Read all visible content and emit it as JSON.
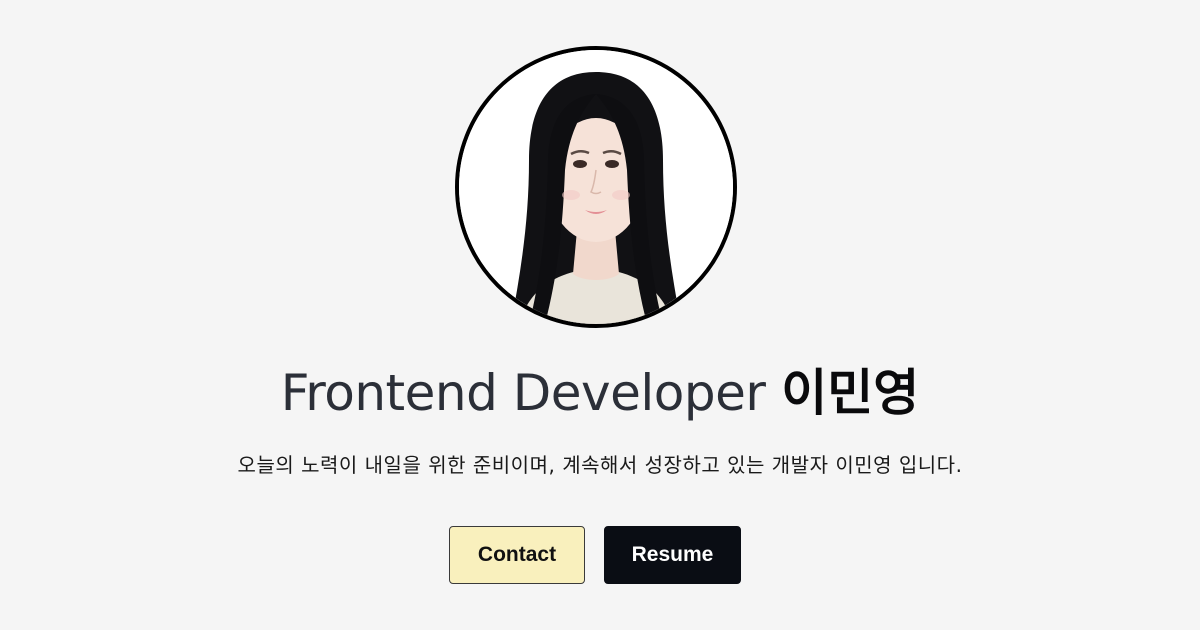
{
  "hero": {
    "role": "Frontend Developer",
    "name": "이민영",
    "intro": "오늘의 노력이 내일을 위한 준비이며, 계속해서 성장하고 있는 개발자 이민영 입니다."
  },
  "actions": {
    "contact_label": "Contact",
    "resume_label": "Resume"
  },
  "colors": {
    "background": "#f5f5f5",
    "contact_bg": "#f9f0bd",
    "resume_bg": "#0a0d14"
  }
}
